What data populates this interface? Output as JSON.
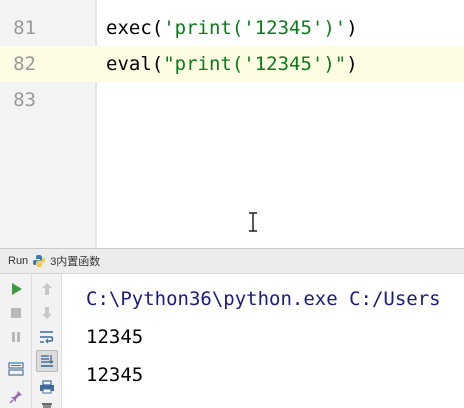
{
  "editor": {
    "lines": [
      {
        "number": "81",
        "prefix": "exec(",
        "string": "'print('12345')'",
        "suffix": ")"
      },
      {
        "number": "82",
        "prefix": "eval(",
        "string": "\"print('12345')\"",
        "suffix": ")"
      },
      {
        "number": "83",
        "prefix": "",
        "string": "",
        "suffix": ""
      }
    ],
    "current_line_color": "#fffce4",
    "string_color": "#067d17"
  },
  "run_panel": {
    "title": "Run",
    "config_name": "3内置函数",
    "toolbar_left": [
      {
        "icon": "run-icon"
      },
      {
        "icon": "stop-icon"
      },
      {
        "icon": "pause-icon"
      },
      {
        "icon": "layout-icon"
      },
      {
        "icon": "pin-icon"
      }
    ],
    "toolbar_right": [
      {
        "icon": "arrow-up-icon"
      },
      {
        "icon": "arrow-down-icon"
      },
      {
        "icon": "soft-wrap-icon"
      },
      {
        "icon": "scroll-to-end-icon"
      },
      {
        "icon": "print-icon"
      },
      {
        "icon": "trash-icon"
      }
    ],
    "run_icon_color": "#3f9b3f"
  },
  "console": {
    "lines": [
      "C:\\Python36\\python.exe C:/Users",
      "12345",
      "12345"
    ]
  }
}
